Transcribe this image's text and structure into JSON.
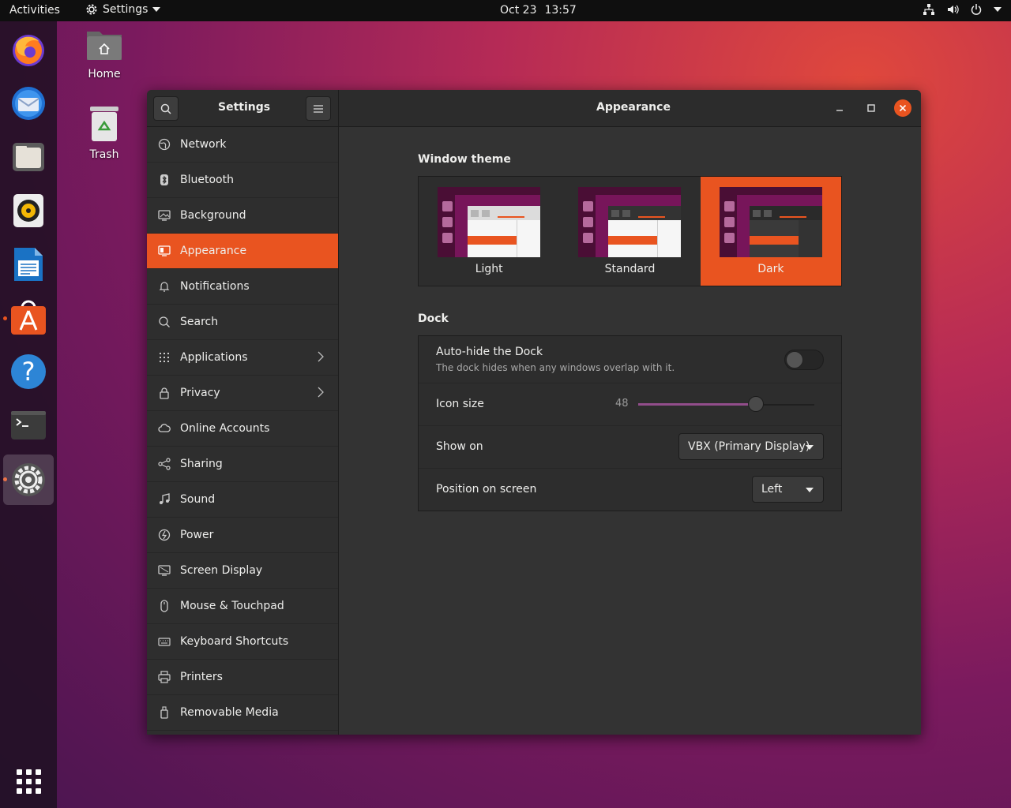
{
  "topbar": {
    "activities": "Activities",
    "app_name": "Settings",
    "date": "Oct 23",
    "time": "13:57"
  },
  "desktop": {
    "home_label": "Home",
    "trash_label": "Trash"
  },
  "dock": {
    "items": [
      {
        "name": "Firefox",
        "icon": "firefox-icon"
      },
      {
        "name": "Thunderbird",
        "icon": "thunderbird-icon"
      },
      {
        "name": "Files",
        "icon": "files-icon"
      },
      {
        "name": "Rhythmbox",
        "icon": "rhythmbox-icon"
      },
      {
        "name": "LibreOffice Writer",
        "icon": "writer-icon"
      },
      {
        "name": "Ubuntu Software",
        "icon": "software-icon"
      },
      {
        "name": "Help",
        "icon": "help-icon"
      },
      {
        "name": "Terminal",
        "icon": "terminal-icon"
      },
      {
        "name": "Settings",
        "icon": "settings-icon"
      }
    ],
    "show_apps_icon": "app-grid-icon"
  },
  "window": {
    "sidebar_title": "Settings",
    "content_title": "Appearance"
  },
  "sidebar": {
    "items": [
      {
        "label": "Network",
        "icon": "globe-icon"
      },
      {
        "label": "Bluetooth",
        "icon": "bluetooth-icon"
      },
      {
        "label": "Background",
        "icon": "monitor-icon"
      },
      {
        "label": "Appearance",
        "icon": "appearance-icon"
      },
      {
        "label": "Notifications",
        "icon": "bell-icon"
      },
      {
        "label": "Search",
        "icon": "search-icon"
      },
      {
        "label": "Applications",
        "icon": "grid-icon"
      },
      {
        "label": "Privacy",
        "icon": "lock-icon"
      },
      {
        "label": "Online Accounts",
        "icon": "cloud-icon"
      },
      {
        "label": "Sharing",
        "icon": "share-icon"
      },
      {
        "label": "Sound",
        "icon": "music-note-icon"
      },
      {
        "label": "Power",
        "icon": "power-icon"
      },
      {
        "label": "Screen Display",
        "icon": "display-icon"
      },
      {
        "label": "Mouse & Touchpad",
        "icon": "mouse-icon"
      },
      {
        "label": "Keyboard Shortcuts",
        "icon": "keyboard-icon"
      },
      {
        "label": "Printers",
        "icon": "printer-icon"
      },
      {
        "label": "Removable Media",
        "icon": "usb-icon"
      }
    ],
    "selected": "Appearance"
  },
  "appearance": {
    "window_theme_title": "Window theme",
    "themes": [
      "Light",
      "Standard",
      "Dark"
    ],
    "selected_theme": "Dark",
    "dock_title": "Dock",
    "autohide_label": "Auto-hide the Dock",
    "autohide_sub": "The dock hides when any windows overlap with it.",
    "autohide_on": false,
    "icon_size_label": "Icon size",
    "icon_size_value": "48",
    "icon_size_fraction": 0.67,
    "show_on_label": "Show on",
    "show_on_value": "VBX (Primary Display)",
    "position_label": "Position on screen",
    "position_value": "Left"
  },
  "colors": {
    "accent": "#e95420",
    "window_bg": "#333333",
    "sidebar_bg": "#2e2e2e"
  }
}
